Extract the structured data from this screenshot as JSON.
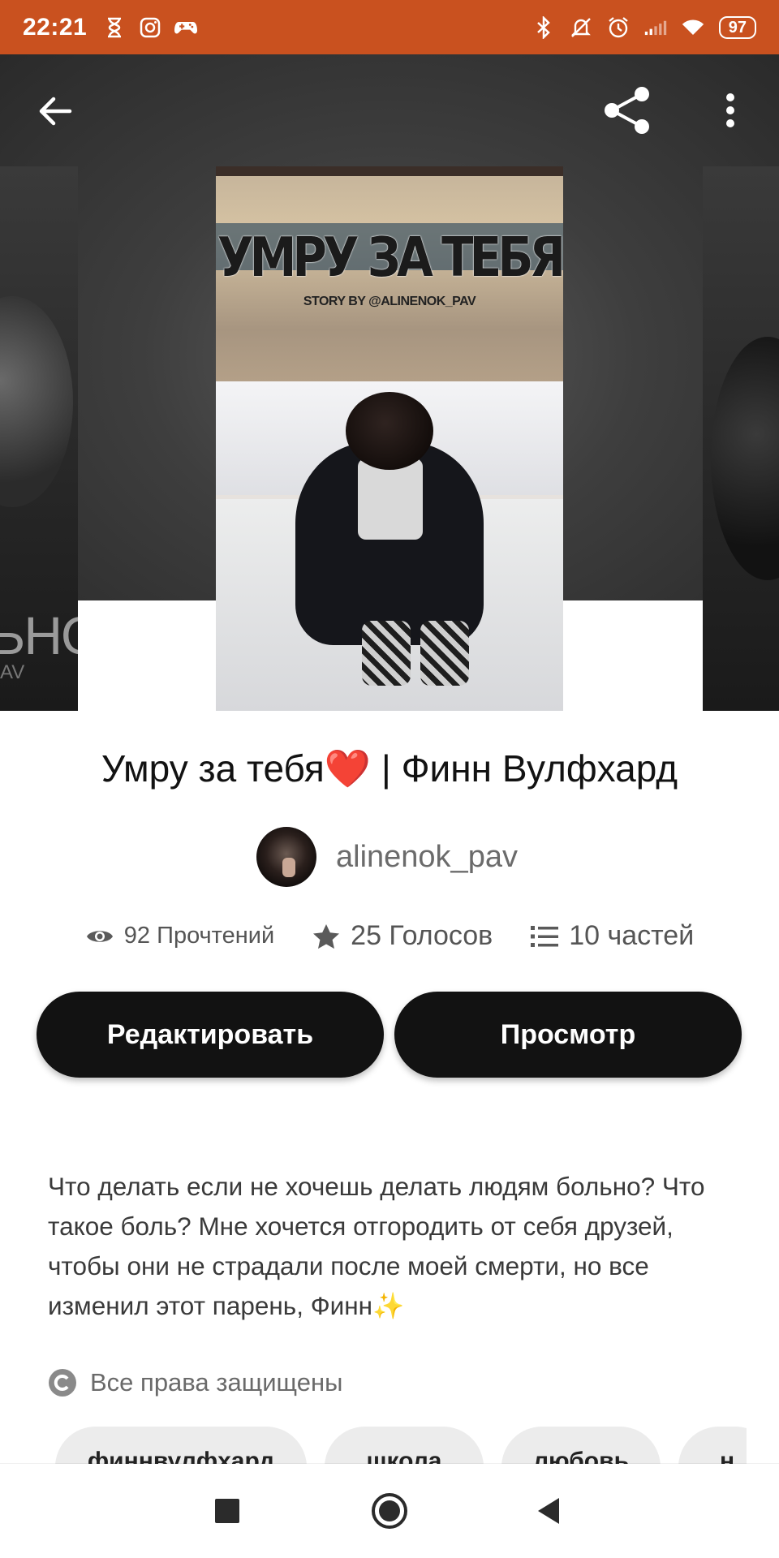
{
  "status_bar": {
    "time": "22:21",
    "battery": "97",
    "left_icons": [
      "hourglass-icon",
      "instagram-icon",
      "gamepad-icon"
    ],
    "right_icons": [
      "bluetooth-icon",
      "mute-icon",
      "alarm-icon",
      "signal-icon",
      "wifi-icon",
      "battery-icon"
    ]
  },
  "toolbar": {
    "icons": [
      "back-arrow-icon",
      "share-icon",
      "more-vert-icon"
    ]
  },
  "cover": {
    "title": "УМРУ ЗА ТЕБЯ",
    "byline": "STORY BY @ALINENOK_PAV",
    "left_neighbor_text": "ЬНО",
    "left_neighbor_small": "AV"
  },
  "story": {
    "title": "Умру за тебя❤️ | Финн Вулфхард",
    "author": "alinenok_pav",
    "reads": "92 Прочтений",
    "votes": "25 Голосов",
    "parts": "10 частей"
  },
  "buttons": {
    "edit": "Редактировать",
    "view": "Просмотр"
  },
  "description": "Что делать если не хочешь делать людям больно? Что такое боль? Мне хочется отгородить от себя друзей, чтобы они не страдали после моей смерти, но все изменил этот парень, Финн",
  "description_emoji": "✨",
  "rights": "Все права защищены",
  "tags": [
    "финнвулфхард",
    "школа",
    "любовь",
    "н"
  ],
  "colors": {
    "status_bar": "#c9511f",
    "button": "#121212",
    "tag_bg": "#ececec"
  },
  "nav_icons": [
    "recents-square-icon",
    "home-circle-icon",
    "back-triangle-icon"
  ]
}
